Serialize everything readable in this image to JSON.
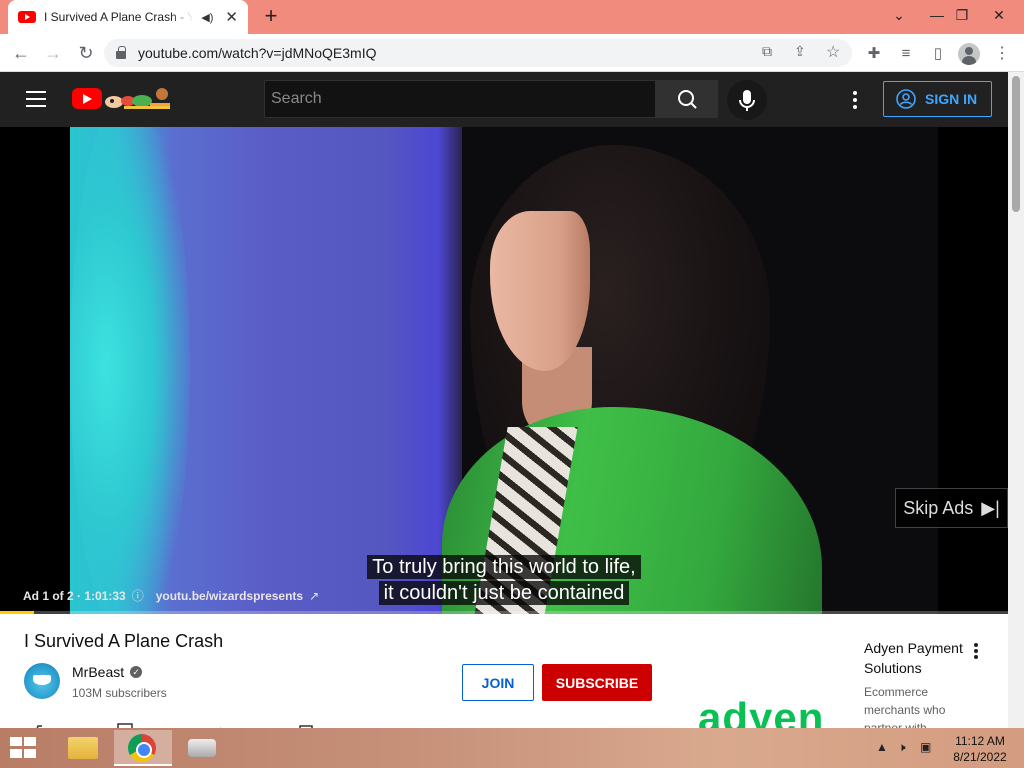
{
  "browser": {
    "tab_title": "I Survived A Plane Crash - YouTube",
    "url": "youtube.com/watch?v=jdMNoQE3mIQ"
  },
  "youtube": {
    "search_placeholder": "Search",
    "sign_in_label": "SIGN IN"
  },
  "player": {
    "skip_ads_label": "Skip Ads",
    "caption_lines": [
      "To truly bring this world to life,",
      "it couldn't just be contained"
    ],
    "ad_info": "Ad 1 of 2 · 1:01:33",
    "ad_link": "youtu.be/wizardspresents",
    "progress": 0.034
  },
  "video": {
    "title": "I Survived A Plane Crash",
    "channel_name": "MrBeast",
    "subscribers": "103M subscribers",
    "join_label": "JOIN",
    "subscribe_label": "SUBSCRIBE"
  },
  "sidebar_ad": {
    "title": "Adyen Payment Solutions",
    "description": "Ecommerce merchants who partner with",
    "logo_text": "adyen"
  },
  "taskbar": {
    "time": "11:12 AM",
    "date": "8/21/2022"
  },
  "colors": {
    "tab_strip": "#f18b7e",
    "youtube_header": "#212121",
    "subscribe": "#cc0000",
    "sign_in": "#3ea6ff",
    "adyen_green": "#0abf53"
  }
}
